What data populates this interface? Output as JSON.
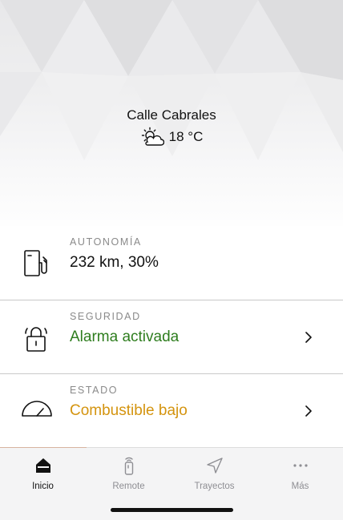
{
  "header": {
    "location": "Calle Cabrales",
    "weather_icon": "partly-cloudy-icon",
    "temperature": "18 °C"
  },
  "cards": [
    {
      "label": "AUTONOMÍA",
      "value": "232 km, 30%",
      "icon": "fuel-pump-icon",
      "value_color": "#111111",
      "has_chevron": false
    },
    {
      "label": "SEGURIDAD",
      "value": "Alarma activada",
      "icon": "padlock-alarm-icon",
      "value_color": "#2e7d1e",
      "has_chevron": true
    },
    {
      "label": "ESTADO",
      "value": "Combustible bajo",
      "icon": "gauge-icon",
      "value_color": "#d4940f",
      "has_chevron": true
    }
  ],
  "tabs": [
    {
      "label": "Inicio",
      "icon": "home-icon",
      "active": true
    },
    {
      "label": "Remote",
      "icon": "car-key-icon",
      "active": false
    },
    {
      "label": "Trayectos",
      "icon": "navigation-arrow-icon",
      "active": false
    },
    {
      "label": "Más",
      "icon": "more-dots-icon",
      "active": false
    }
  ],
  "colors": {
    "ok_green": "#2e7d1e",
    "warning_amber": "#d4940f",
    "active_tab": "#111111",
    "inactive_tab": "#8e8e93"
  }
}
